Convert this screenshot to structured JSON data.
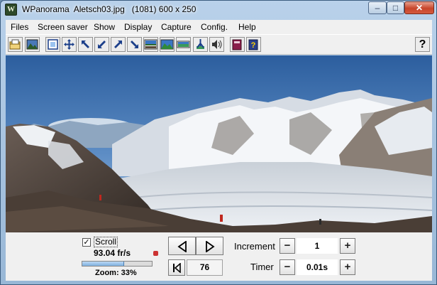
{
  "window": {
    "title": "WPanorama  Aletsch03.jpg   (1081) 600 x 250",
    "app_icon_letter": "W",
    "controls": {
      "minimize": "–",
      "maximize": "□",
      "close": "✕"
    }
  },
  "menu": {
    "items": [
      "Files",
      "Screen saver",
      "Show",
      "Display",
      "Capture",
      "Config.",
      "Help"
    ]
  },
  "toolbar": {
    "help_label": "?",
    "buttons": [
      "open-folder-icon",
      "picture-icon",
      "fit-window-icon",
      "full-screen-icon",
      "arrow-up-left-icon",
      "arrow-down-left-icon",
      "arrow-up-right-icon",
      "arrow-down-right-icon",
      "panorama-view-1-icon",
      "panorama-view-2-icon",
      "panorama-view-3-icon",
      "tripod-icon",
      "speaker-icon",
      "book-icon",
      "help-book-icon"
    ]
  },
  "panel": {
    "scroll_checked": true,
    "scroll_check_mark": "✓",
    "scroll_label": "Scroll",
    "fps": "93.04 fr/s",
    "zoom_label": "Zoom: 33%",
    "zoom_percent": 33,
    "frame_number": "76",
    "increment_label": "Increment",
    "increment_value": "1",
    "timer_label": "Timer",
    "timer_value": "0.01s",
    "minus": "−",
    "plus": "+"
  },
  "colors": {
    "sky_top": "#2c5e9e",
    "sky_bottom": "#9dbde0",
    "snow": "#f2f4f7",
    "rock": "#4a3e36"
  }
}
